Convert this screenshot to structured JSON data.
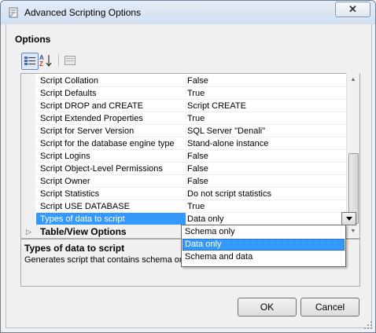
{
  "window": {
    "title": "Advanced Scripting Options",
    "close_glyph": "✕"
  },
  "options_title": "Options",
  "toolbar": {
    "categorized_icon": "categorized-icon",
    "alphabetical_icon": "alphabetical-az-icon",
    "property_pages_icon": "property-pages-icon"
  },
  "grid": {
    "rows": [
      {
        "name": "Script Collation",
        "value": "False"
      },
      {
        "name": "Script Defaults",
        "value": "True"
      },
      {
        "name": "Script DROP and CREATE",
        "value": "Script CREATE"
      },
      {
        "name": "Script Extended Properties",
        "value": "True"
      },
      {
        "name": "Script for Server Version",
        "value": "SQL Server \"Denali\""
      },
      {
        "name": "Script for the database engine type",
        "value": "Stand-alone instance"
      },
      {
        "name": "Script Logins",
        "value": "False"
      },
      {
        "name": "Script Object-Level Permissions",
        "value": "False"
      },
      {
        "name": "Script Owner",
        "value": "False"
      },
      {
        "name": "Script Statistics",
        "value": "Do not script statistics"
      },
      {
        "name": "Script USE DATABASE",
        "value": "True"
      },
      {
        "name": "Types of data to script",
        "value": "Data only"
      }
    ],
    "category": {
      "label": "Table/View Options",
      "expander": "▷"
    }
  },
  "dropdown": {
    "options": [
      "Schema only",
      "Data only",
      "Schema and data"
    ],
    "selected": "Data only"
  },
  "description": {
    "title": "Types of data to script",
    "text": "Generates script that contains schema only"
  },
  "buttons": {
    "ok": "OK",
    "cancel": "Cancel"
  },
  "colors": {
    "selection": "#3399ff",
    "title_bar": "#d3dff0"
  }
}
